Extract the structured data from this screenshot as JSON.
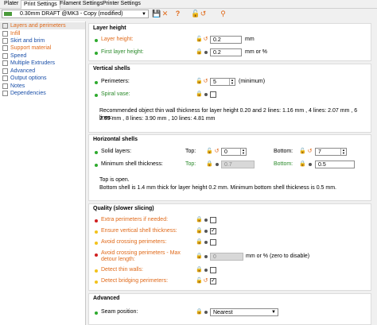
{
  "tabs": [
    "Plater",
    "Print Settings",
    "Filament Settings",
    "Printer Settings"
  ],
  "preset": {
    "name": "0.30mm DRAFT @MK3 - Copy (modified)"
  },
  "colors": {
    "orange": "#e06a1a",
    "green": "#2eaa2e",
    "yellow": "#f2c21a",
    "red": "#d02020"
  },
  "sidebar": {
    "items": [
      {
        "label": "Layers and perimeters",
        "color": "orange"
      },
      {
        "label": "Infill",
        "color": "orange"
      },
      {
        "label": "Skirt and brim",
        "color": "blue"
      },
      {
        "label": "Support material",
        "color": "orange"
      },
      {
        "label": "Speed",
        "color": "blue"
      },
      {
        "label": "Multiple Extruders",
        "color": "blue"
      },
      {
        "label": "Advanced",
        "color": "blue"
      },
      {
        "label": "Output options",
        "color": "blue"
      },
      {
        "label": "Notes",
        "color": "blue"
      },
      {
        "label": "Dependencies",
        "color": "blue"
      }
    ]
  },
  "layer_height": {
    "title": "Layer height",
    "layer_height_label": "Layer height:",
    "layer_height_value": "0.2",
    "layer_height_unit": "mm",
    "first_layer_label": "First layer height:",
    "first_layer_value": "0.2",
    "first_layer_unit": "mm or %"
  },
  "vertical_shells": {
    "title": "Vertical shells",
    "perimeters_label": "Perimeters:",
    "perimeters_value": "5",
    "perimeters_suffix": "(minimum)",
    "spiral_label": "Spiral vase:",
    "note_line1": "Recommended object thin wall thickness for layer height 0.20 and 2 lines: 1.16 mm , 4 lines: 2.07 mm , 6 lines:",
    "note_line2": "2.99 mm , 8 lines: 3.90 mm , 10 lines: 4.81 mm"
  },
  "horizontal_shells": {
    "title": "Horizontal shells",
    "solid_label": "Solid layers:",
    "top_label": "Top:",
    "top_value": "0",
    "bottom_label": "Bottom:",
    "bottom_value": "7",
    "min_shell_label": "Minimum shell thickness:",
    "min_top_label": "Top:",
    "min_top_value": "0.7",
    "min_bottom_label": "Bottom:",
    "min_bottom_value": "0.5",
    "note_line1": "Top is open.",
    "note_line2": "Bottom shell is 1.4 mm thick for layer height 0.2 mm. Minimum bottom shell thickness is 0.5 mm."
  },
  "quality": {
    "title": "Quality (slower slicing)",
    "extra_perimeters": "Extra perimeters if needed:",
    "ensure_vertical": "Ensure vertical shell thickness:",
    "avoid_crossing": "Avoid crossing perimeters:",
    "max_detour_line1": "Avoid crossing perimeters - Max",
    "max_detour_line2": "detour length:",
    "max_detour_value": "0",
    "max_detour_unit": "mm or % (zero to disable)",
    "detect_thin": "Detect thin walls:",
    "detect_bridging": "Detect bridging perimeters:",
    "ensure_vertical_checked": "✓",
    "detect_bridging_checked": "✓"
  },
  "advanced": {
    "title": "Advanced",
    "seam_label": "Seam position:",
    "seam_value": "Nearest"
  }
}
